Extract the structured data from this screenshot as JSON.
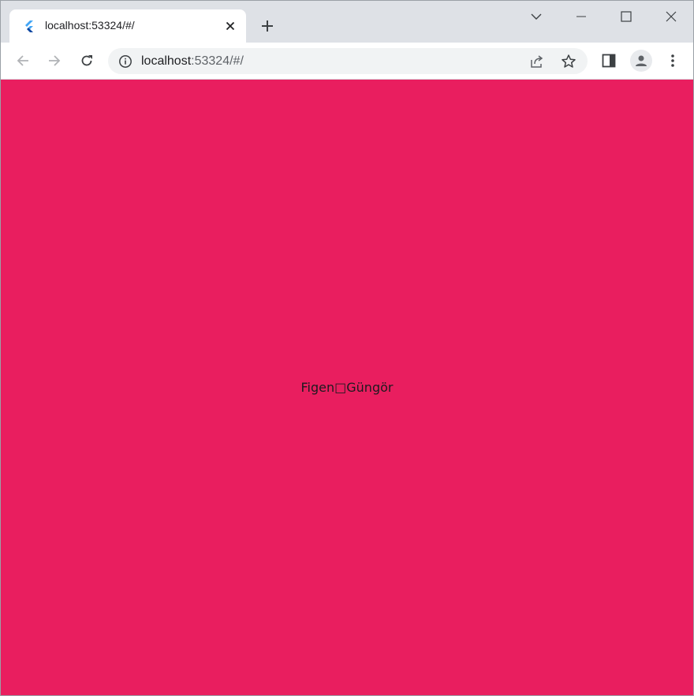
{
  "browser": {
    "tab": {
      "title": "localhost:53324/#/",
      "favicon": "flutter-icon"
    },
    "address_bar": {
      "host": "localhost",
      "rest": ":53324/#/"
    },
    "icons": {
      "close_tab": "close-icon",
      "new_tab": "plus-icon",
      "tab_search": "chevron-down-icon",
      "minimize": "minimize-icon",
      "maximize": "maximize-icon",
      "close_window": "close-icon",
      "back": "back-arrow-icon",
      "forward": "forward-arrow-icon",
      "reload": "reload-icon",
      "site_info": "info-icon",
      "share": "share-icon",
      "bookmark": "star-icon",
      "side_panel": "side-panel-icon",
      "profile": "profile-icon",
      "menu": "kebab-menu-icon"
    },
    "colors": {
      "tabstrip": "#dee1e6",
      "omnibox": "#f1f3f4"
    }
  },
  "page": {
    "background": "#e91e5f",
    "center_text": "Figen□Güngör"
  }
}
